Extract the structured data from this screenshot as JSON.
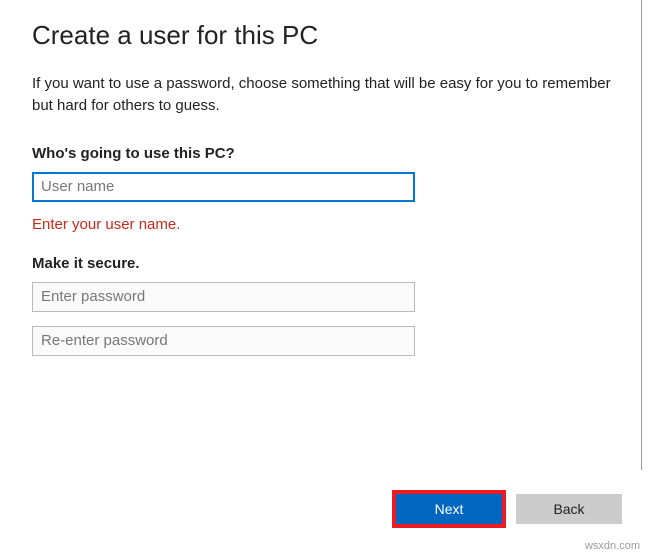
{
  "page": {
    "title": "Create a user for this PC",
    "description": "If you want to use a password, choose something that will be easy for you to remember but hard for others to guess."
  },
  "username_section": {
    "label": "Who's going to use this PC?",
    "placeholder": "User name",
    "error": "Enter your user name."
  },
  "password_section": {
    "label": "Make it secure.",
    "password_placeholder": "Enter password",
    "reenter_placeholder": "Re-enter password"
  },
  "buttons": {
    "next": "Next",
    "back": "Back"
  },
  "watermark": "wsxdn.com"
}
